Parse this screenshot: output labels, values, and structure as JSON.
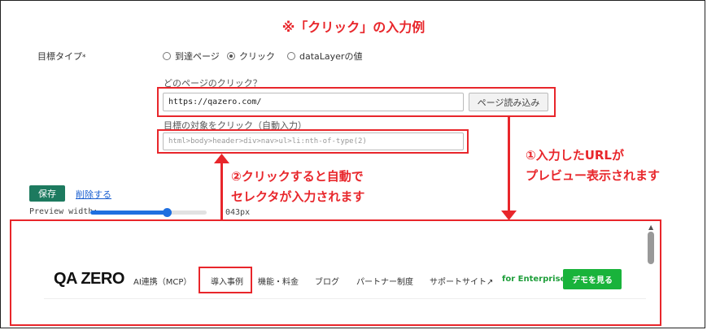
{
  "heading": "※「クリック」の入力例",
  "form": {
    "goal_type_label": "目標タイプ",
    "required_mark": "*",
    "radios": [
      {
        "label": "到達ページ",
        "checked": false
      },
      {
        "label": "クリック",
        "checked": true
      },
      {
        "label": "dataLayerの値",
        "checked": false
      }
    ],
    "which_page_label": "どのページのクリック？",
    "url_value": "https://qazero.com/",
    "load_button": "ページ読み込み",
    "target_label": "目標の対象をクリック（自動入力）",
    "selector_value": "html>body>header>div>nav>ul>li:nth-of-type(2)"
  },
  "actions": {
    "save": "保存",
    "delete": "削除する"
  },
  "preview_width": {
    "label": "Preview width:",
    "value_text": "043px",
    "slider_fraction": 0.66
  },
  "annotations": {
    "note1_line1": "①入力したURLが",
    "note1_line2": "プレビュー表示されます",
    "note2_line1": "②クリックすると自動で",
    "note2_line2": "セレクタが入力されます"
  },
  "preview": {
    "logo": "QA ZERO",
    "nav": [
      "AI連携（MCP）",
      "導入事例",
      "機能・料金",
      "ブログ",
      "パートナー制度",
      "サポートサイト↗",
      "for Enterprise"
    ],
    "demo_button": "デモを見る"
  },
  "colors": {
    "annotation_red": "#e8262b",
    "save_green": "#1d7a5f",
    "demo_green": "#19b33b",
    "enterprise_green": "#1e9e3a",
    "slider_blue": "#1f6fe0"
  }
}
